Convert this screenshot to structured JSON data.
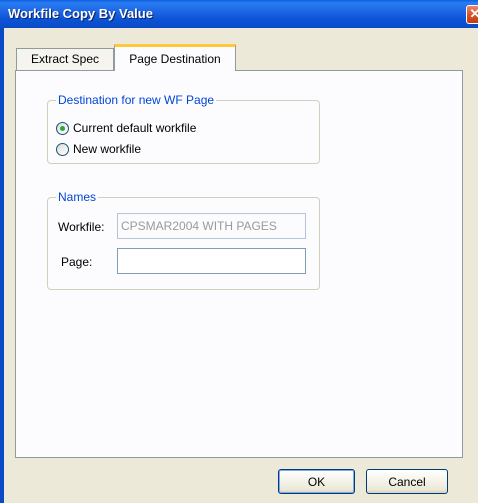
{
  "window": {
    "title": "Workfile Copy By Value",
    "close_glyph": "✕"
  },
  "tabs": [
    {
      "label": "Extract Spec",
      "active": false
    },
    {
      "label": "Page Destination",
      "active": true
    }
  ],
  "destination_group": {
    "legend": "Destination for new WF Page",
    "options": [
      {
        "label": "Current default workfile",
        "checked": true
      },
      {
        "label": "New workfile",
        "checked": false
      }
    ]
  },
  "names_group": {
    "legend": "Names",
    "workfile_label": "Workfile:",
    "workfile_value": "CPSMAR2004 WITH PAGES",
    "page_label": "Page:",
    "page_value": ""
  },
  "buttons": {
    "ok": "OK",
    "cancel": "Cancel"
  }
}
